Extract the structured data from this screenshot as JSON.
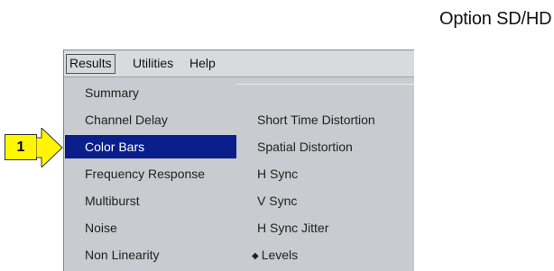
{
  "header": {
    "title": "Option SD/HD"
  },
  "menubar": {
    "items": [
      "Results",
      "Utilities",
      "Help"
    ]
  },
  "menu": {
    "left_items": [
      "Summary",
      "Channel Delay",
      "Color Bars",
      "Frequency Response",
      "Multiburst",
      "Noise",
      "Non Linearity"
    ],
    "right_items": [
      "Short Time Distortion",
      "Spatial Distortion",
      "H Sync",
      "V Sync",
      "H Sync Jitter",
      "Levels"
    ],
    "highlighted": "Color Bars",
    "selected_marker_item": "Levels"
  },
  "callout": {
    "label": "1"
  },
  "colors": {
    "highlight": "#0a1e8c",
    "callout_fill": "#fff600",
    "menu_bg": "#c8cbd0"
  }
}
